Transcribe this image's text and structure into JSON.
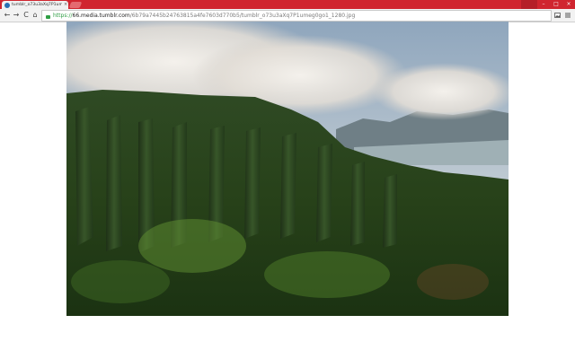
{
  "browser": {
    "tab_title": "tumblr_o73u3aXq7P1umeg0go1_1280.jpg",
    "tab_close": "×",
    "url_scheme": "https://",
    "url_host": "66.media.tumblr.com",
    "url_path": "/6b79a7445b24763815a4fe7603d770b5/tumblr_o73u3aXq7P1umeg0go1_1280.jpg",
    "nav": {
      "back": "←",
      "forward": "→",
      "reload": "C",
      "home": "⌂"
    },
    "window_buttons": {
      "minimize": "–",
      "maximize": "□",
      "close": "×"
    },
    "colors": {
      "accent": "#d0252f",
      "secure": "#2f9e44"
    }
  },
  "content": {
    "image_subject": "aerial view of green mountain ridges under clouds"
  }
}
